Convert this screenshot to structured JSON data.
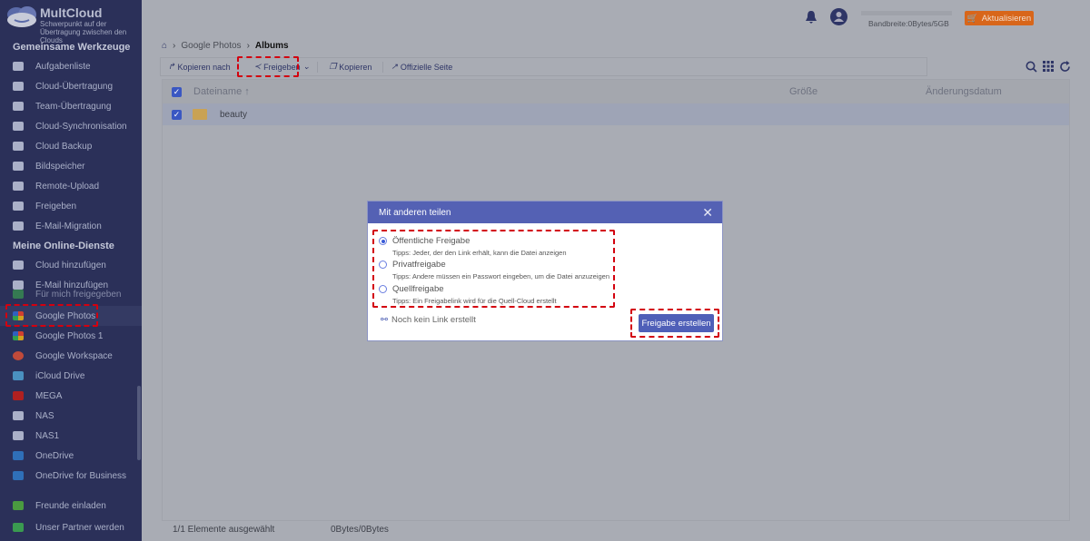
{
  "brand": {
    "name": "MultCloud",
    "tagline": "Schwerpunkt auf der Übertragung zwischen den Clouds"
  },
  "sidebar": {
    "section1": "Gemeinsame Werkzeuge",
    "tools": [
      {
        "label": "Aufgabenliste"
      },
      {
        "label": "Cloud-Übertragung"
      },
      {
        "label": "Team-Übertragung"
      },
      {
        "label": "Cloud-Synchronisation"
      },
      {
        "label": "Cloud Backup"
      },
      {
        "label": "Bildspeicher"
      },
      {
        "label": "Remote-Upload"
      },
      {
        "label": "Freigeben"
      },
      {
        "label": "E-Mail-Migration"
      }
    ],
    "section2": "Meine Online-Dienste",
    "services": [
      {
        "label": "Cloud hinzufügen"
      },
      {
        "label": "E-Mail hinzufügen"
      },
      {
        "label": "Für mich freigegeben"
      },
      {
        "label": "Google Photos"
      },
      {
        "label": "Google Photos 1"
      },
      {
        "label": "Google Workspace"
      },
      {
        "label": "iCloud Drive"
      },
      {
        "label": "MEGA"
      },
      {
        "label": "NAS"
      },
      {
        "label": "NAS1"
      },
      {
        "label": "OneDrive"
      },
      {
        "label": "OneDrive for Business"
      }
    ],
    "bottom": [
      {
        "label": "Freunde einladen"
      },
      {
        "label": "Unser Partner werden"
      }
    ],
    "active": "Google Photos"
  },
  "header": {
    "bandwidth": "Bandbreite:0Bytes/5GB",
    "upgrade": "Aktualisieren"
  },
  "breadcrumb": {
    "parent": "Google Photos",
    "current": "Albums"
  },
  "toolbar": {
    "copy_to": "Kopieren nach",
    "share": "Freigeben",
    "copy": "Kopieren",
    "official": "Offizielle Seite"
  },
  "table": {
    "columns": {
      "name": "Dateiname ↑",
      "size": "Größe",
      "date": "Änderungsdatum"
    },
    "rows": [
      {
        "name": "beauty",
        "selected": true
      }
    ]
  },
  "footer": {
    "selected": "1/1 Elemente ausgewählt",
    "size": "0Bytes/0Bytes"
  },
  "modal": {
    "title": "Mit anderen teilen",
    "options": [
      {
        "label": "Öffentliche Freigabe",
        "tip": "Tipps: Jeder, der den Link erhält, kann die Datei anzeigen",
        "checked": true
      },
      {
        "label": "Privatfreigabe",
        "tip": "Tipps: Andere müssen ein Passwort eingeben, um die Datei anzuzeigen",
        "checked": false
      },
      {
        "label": "Quellfreigabe",
        "tip": "Tipps: Ein Freigabelink wird für die Quell-Cloud erstellt",
        "checked": false
      }
    ],
    "link_status": "Noch kein Link erstellt",
    "create": "Freigabe erstellen"
  },
  "colors": {
    "sidebar": "#2b3059",
    "modal_header": "#5461b4",
    "upgrade": "#d8661a",
    "highlight": "#d3000f"
  }
}
